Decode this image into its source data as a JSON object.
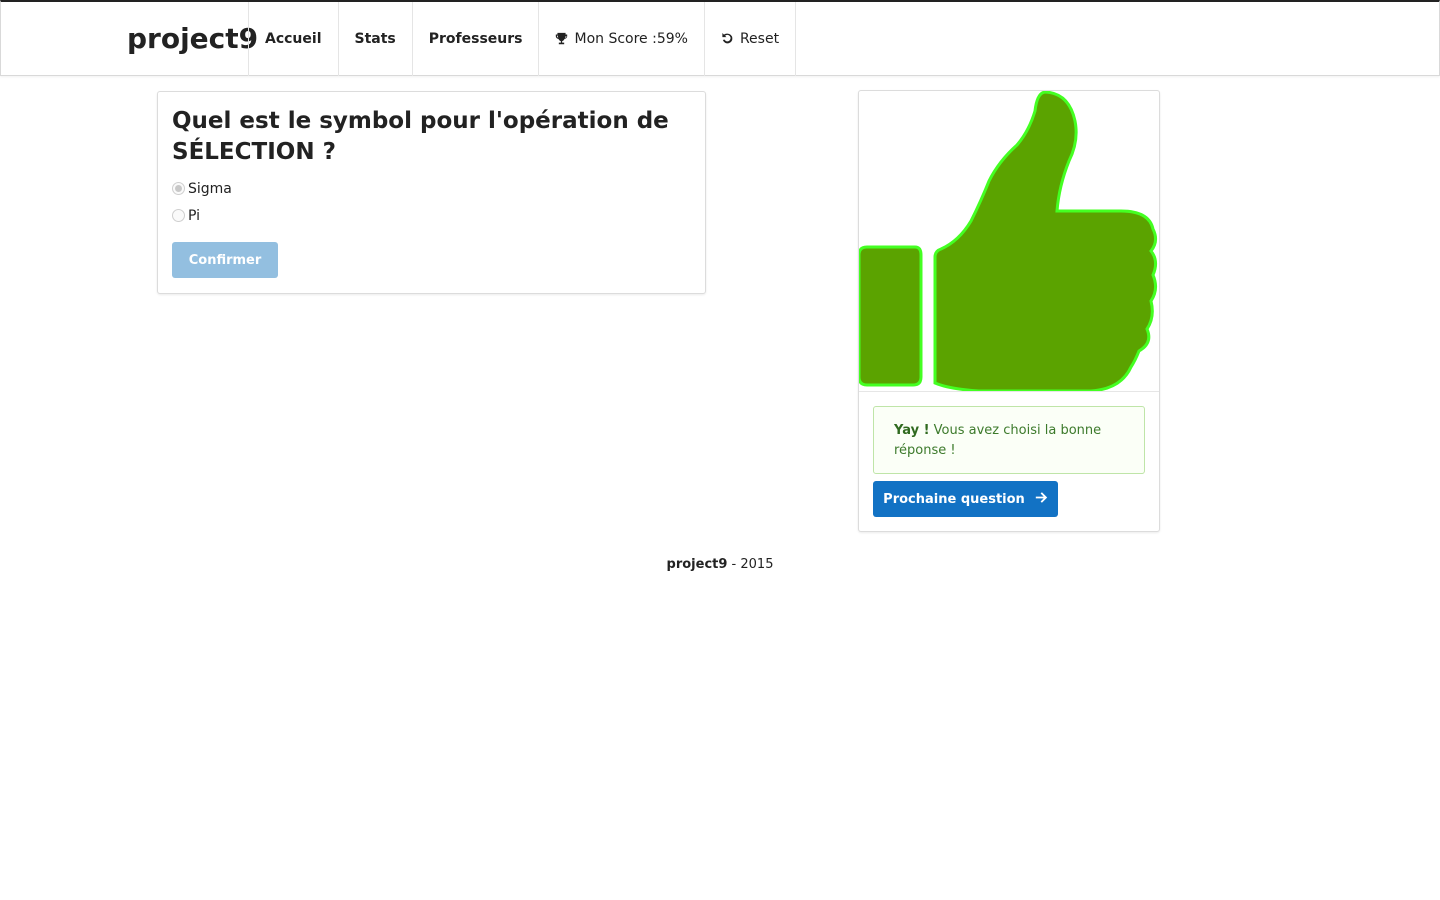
{
  "navbar": {
    "brand": "project9",
    "items": [
      {
        "label": "Accueil"
      },
      {
        "label": "Stats"
      },
      {
        "label": "Professeurs"
      },
      {
        "label": "Mon Score :59%",
        "icon": "trophy-icon"
      },
      {
        "label": "Reset",
        "icon": "reset-icon"
      }
    ]
  },
  "question": {
    "title": "Quel est le symbol pour l'opération de SÉLECTION ?",
    "options": [
      {
        "label": "Sigma",
        "selected": true
      },
      {
        "label": "Pi",
        "selected": false
      }
    ],
    "confirm_label": "Confirmer"
  },
  "result": {
    "image_icon": "thumbs-up-icon",
    "alert_strong": "Yay !",
    "alert_text": " Vous avez choisi la bonne réponse !",
    "next_label": "Prochaine question",
    "next_icon": "arrow-right-icon"
  },
  "footer": {
    "brand": "project9",
    "year_text": " - 2015"
  },
  "colors": {
    "thumb_fill": "#5ba300",
    "thumb_outline": "#44ff22",
    "primary": "#1272c4",
    "disabled_primary": "#93bfe0",
    "success_text": "#3c7a2b"
  }
}
